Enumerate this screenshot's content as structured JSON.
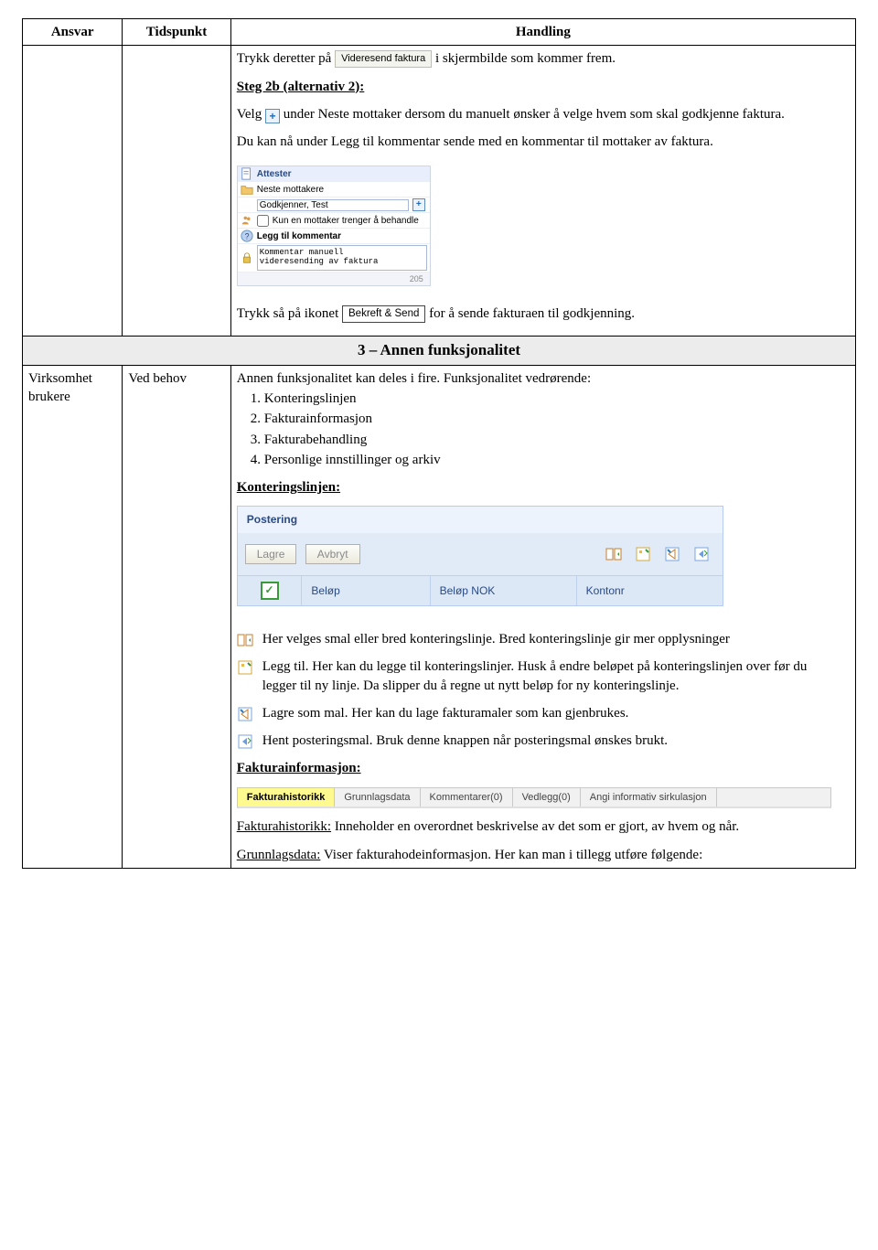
{
  "headers": {
    "ansvar": "Ansvar",
    "tidspunkt": "Tidspunkt",
    "handling": "Handling"
  },
  "section_banner": "3 – Annen funksjonalitet",
  "row1": {
    "trykk_pre": "Trykk deretter på ",
    "trykk_btn": "Videresend faktura",
    "trykk_post": " i skjermbilde som kommer frem.",
    "step2b_title": "Steg 2b (alternativ 2):",
    "velg_pre": "Velg ",
    "velg_post": " under Neste mottaker dersom du manuelt ønsker å velge hvem som skal godkjenne faktura.",
    "velg_add": "Du kan nå under Legg til kommentar sende med en kommentar til mottaker av faktura.",
    "panel": {
      "attester": "Attester",
      "neste": "Neste mottakere",
      "recipient": "Godkjenner, Test",
      "kun_en": "Kun en mottaker trenger å behandle",
      "legg_til": "Legg til kommentar",
      "kommentar_text": "Kommentar manuell\nvideresending av faktura",
      "num": "205"
    },
    "trykk2_pre": "Trykk så på ikonet ",
    "trykk2_btn": "Bekreft & Send",
    "trykk2_post": " for å sende fakturaen til godkjenning."
  },
  "row2": {
    "ansvar": "Virksomhet brukere",
    "tid": "Ved behov",
    "intro": "Annen funksjonalitet kan deles i fire. Funksjonalitet vedrørende:",
    "list": [
      "Konteringslinjen",
      "Fakturainformasjon",
      "Fakturabehandling",
      "Personlige innstillinger og arkiv"
    ],
    "kont_title": "Konteringslinjen:",
    "postering": {
      "title": "Postering",
      "lagre": "Lagre",
      "avbryt": "Avbryt",
      "cols": {
        "belop": "Beløp",
        "belop_nok": "Beløp NOK",
        "kontonr": "Kontonr"
      }
    },
    "expl1": "Her velges smal eller bred konteringslinje. Bred konteringslinje gir mer opplysninger",
    "expl2": "Legg til. Her kan du legge til konteringslinjer. Husk å endre beløpet på konteringslinjen over før du legger til ny linje. Da slipper du å regne ut nytt beløp for ny konteringslinje.",
    "expl3": "Lagre som mal. Her kan du lage fakturamaler som kan gjenbrukes.",
    "expl4": "Hent posteringsmal. Bruk denne knappen når posteringsmal ønskes brukt.",
    "fakt_title": "Fakturainformasjon:",
    "tabs": [
      "Fakturahistorikk",
      "Grunnlagsdata",
      "Kommentarer(0)",
      "Vedlegg(0)",
      "Angi informativ sirkulasjon"
    ],
    "hist_label": "Fakturahistorikk:",
    "hist_text": " Inneholder en overordnet beskrivelse av det som er gjort, av hvem og når.",
    "grunn_label": "Grunnlagsdata:",
    "grunn_text": " Viser fakturahodeinformasjon. Her kan man i tillegg utføre følgende:"
  }
}
